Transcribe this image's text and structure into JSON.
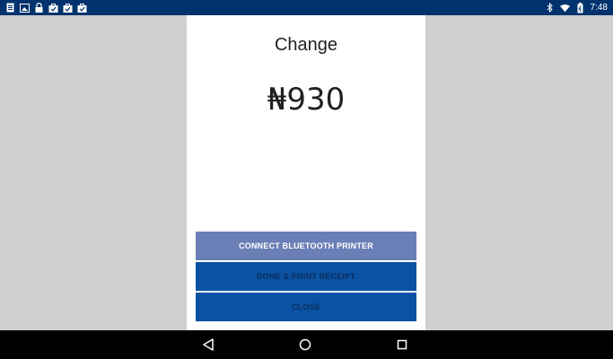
{
  "status_bar": {
    "time": "7:48",
    "left_icons": [
      "notification-document-icon",
      "notification-image-icon",
      "notification-lock-icon",
      "notification-bag-icon",
      "notification-bag-icon",
      "notification-bag-check-icon"
    ],
    "right_icons": [
      "bluetooth-icon",
      "wifi-icon",
      "battery-icon"
    ],
    "background_color": "#00336d"
  },
  "dialog": {
    "title": "Change",
    "amount": "₦930",
    "buttons": {
      "connect_printer": "CONNECT BLUETOOTH PRINTER",
      "done_print": "DONE & PRINT RECEIPT",
      "close": "CLOSE"
    },
    "colors": {
      "connect_button": "#6a7fb6",
      "primary_button": "#0b52a3"
    }
  },
  "nav_bar": {
    "buttons": [
      "back-icon",
      "home-icon",
      "recent-apps-icon"
    ]
  }
}
